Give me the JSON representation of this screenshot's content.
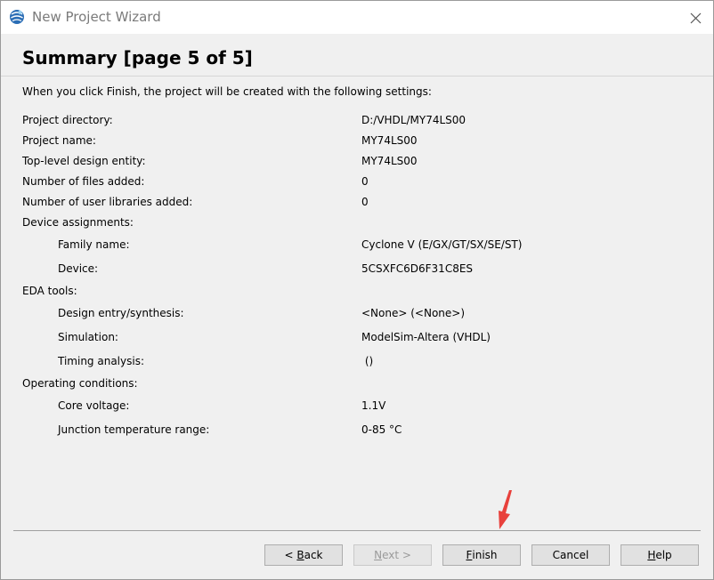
{
  "window": {
    "title": "New Project Wizard"
  },
  "page": {
    "heading": "Summary [page 5 of 5]",
    "intro": "When you click Finish, the project will be created with the following settings:"
  },
  "settings": [
    {
      "label": "Project directory:",
      "value": "D:/VHDL/MY74LS00"
    },
    {
      "label": "Project name:",
      "value": "MY74LS00"
    },
    {
      "label": "Top-level design entity:",
      "value": "MY74LS00"
    },
    {
      "label": "Number of files added:",
      "value": "0"
    },
    {
      "label": "Number of user libraries added:",
      "value": "0"
    },
    {
      "label": "Device assignments:",
      "value": ""
    },
    {
      "label": "Family name:",
      "value": "Cyclone V (E/GX/GT/SX/SE/ST)"
    },
    {
      "label": "Device:",
      "value": "5CSXFC6D6F31C8ES"
    },
    {
      "label": "EDA tools:",
      "value": ""
    },
    {
      "label": "Design entry/synthesis:",
      "value": "<None> (<None>)"
    },
    {
      "label": "Simulation:",
      "value": "ModelSim-Altera (VHDL)"
    },
    {
      "label": "Timing analysis:",
      "value": " ()"
    },
    {
      "label": "Operating conditions:",
      "value": ""
    },
    {
      "label": "Core voltage:",
      "value": "1.1V"
    },
    {
      "label": "Junction temperature range:",
      "value": "0-85 °C"
    }
  ],
  "buttons": {
    "back": {
      "prefix": "< ",
      "mnemonic": "B",
      "rest": "ack"
    },
    "next": {
      "mnemonic": "N",
      "rest": "ext >"
    },
    "finish": {
      "mnemonic": "F",
      "rest": "inish"
    },
    "cancel": "Cancel",
    "help": {
      "mnemonic": "H",
      "rest": "elp"
    }
  },
  "colors": {
    "annotation_arrow": "#e8413c",
    "accent_icon": "#2a6db5"
  },
  "icons": {
    "app": "quartus-globe-icon",
    "close": "close-icon",
    "annotation": "red-arrow-pointer"
  }
}
